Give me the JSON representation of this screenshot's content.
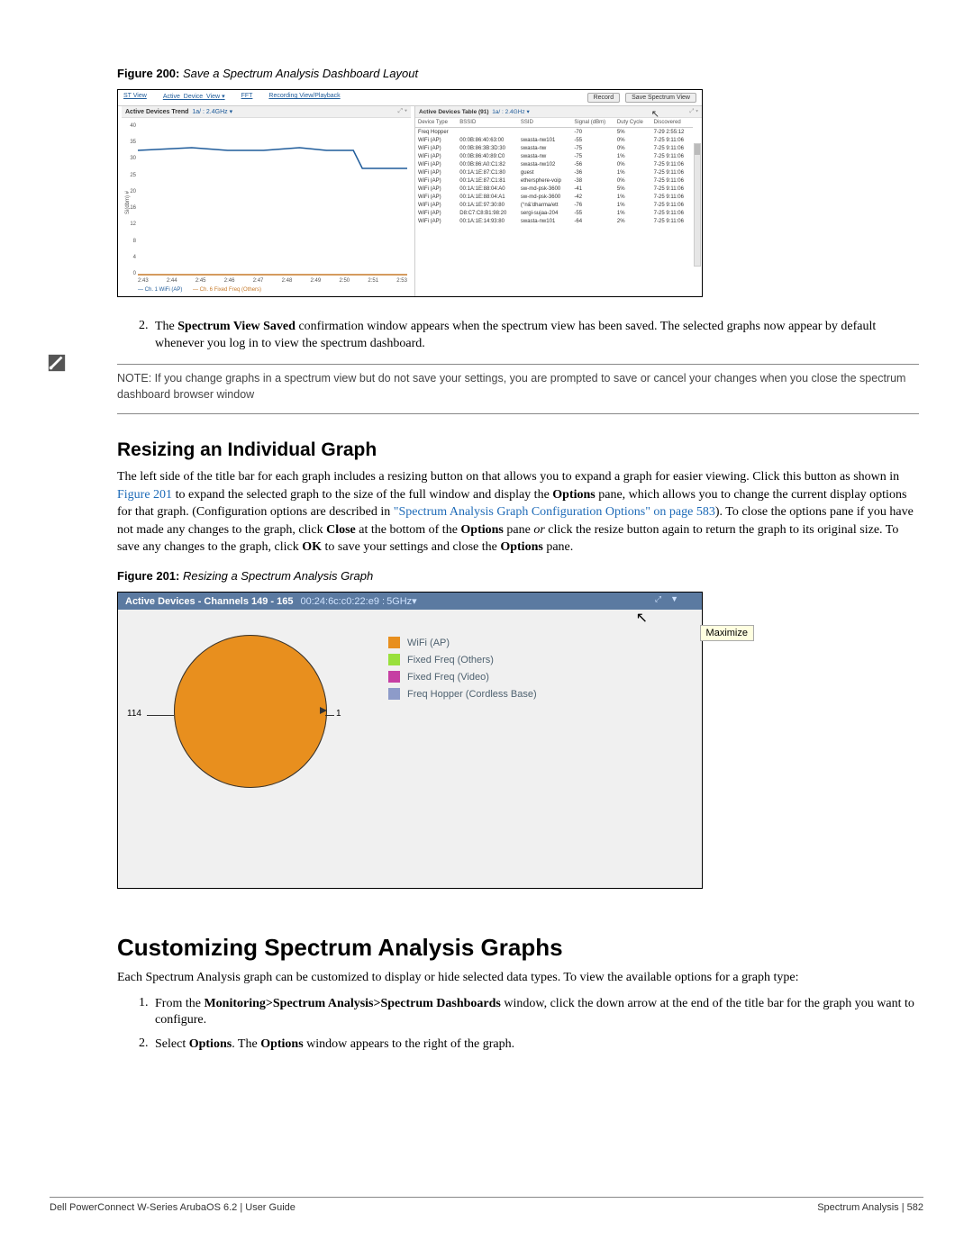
{
  "fig200": {
    "caption_label": "Figure 200:",
    "caption_title": "Save a Spectrum Analysis Dashboard Layout",
    "tabs": [
      "ST View",
      "Active_Device_View",
      "FFT",
      "Recording View/Playback"
    ],
    "buttons": {
      "record": "Record",
      "save": "Save Spectrum View"
    },
    "left_panel": {
      "title": "Active Devices Trend",
      "selector": "1a/ : 2.4GHz ▾",
      "y_label": "Si(dbm) #",
      "legend_a": "— Ch. 1 WiFi (AP)",
      "legend_b": "— Ch. 6 Fixed Freq (Others)"
    },
    "right_panel": {
      "title": "Active Devices Table (91)",
      "selector": "1a/ : 2.4GHz ▾",
      "columns": [
        "Device Type",
        "BSSID",
        "SSID",
        "Signal (dBm)",
        "Duty Cycle",
        "Discovered"
      ],
      "rows": [
        [
          "Freq Hopper",
          "",
          "",
          "-70",
          "5%",
          "7-29 2:55:12"
        ],
        [
          "WiFi (AP)",
          "00:0B:86:40:63:00",
          "swasta-nw101",
          "-55",
          "0%",
          "7-25 9:11:06"
        ],
        [
          "WiFi (AP)",
          "00:0B:86:3B:3D:30",
          "swasta-nw",
          "-75",
          "0%",
          "7-25 9:11:06"
        ],
        [
          "WiFi (AP)",
          "00:0B:86:40:89:C0",
          "swasta-nw",
          "-75",
          "1%",
          "7-25 9:11:06"
        ],
        [
          "WiFi (AP)",
          "00:0B:86:A0:C1:82",
          "swasta-nw102",
          "-56",
          "0%",
          "7-25 9:11:06"
        ],
        [
          "WiFi (AP)",
          "00:1A:1E:87:C1:80",
          "guest",
          "-36",
          "1%",
          "7-25 9:11:06"
        ],
        [
          "WiFi (AP)",
          "00:1A:1E:87:C1:81",
          "ethersphere-voip",
          "-38",
          "0%",
          "7-25 9:11:06"
        ],
        [
          "WiFi (AP)",
          "00:1A:1E:88:04:A0",
          "sw-md-psk-3600",
          "-41",
          "5%",
          "7-25 9:11:06"
        ],
        [
          "WiFi (AP)",
          "00:1A:1E:88:04:A1",
          "sw-md-psk-3600",
          "-42",
          "1%",
          "7-25 9:11:06"
        ],
        [
          "WiFi (AP)",
          "00:1A:1E:97:30:80",
          "(°n&'dharma/ett",
          "-76",
          "1%",
          "7-25 9:11:06"
        ],
        [
          "WiFi (AP)",
          "D8:C7:C8:B1:98:20",
          "sergi-sujaa-204",
          "-55",
          "1%",
          "7-25 9:11:06"
        ],
        [
          "WiFi (AP)",
          "00:1A:1E:14:93:80",
          "swasta-nw101",
          "-64",
          "2%",
          "7-25 9:11:06"
        ]
      ]
    }
  },
  "chart_data": [
    {
      "type": "line",
      "title": "Active Devices Trend",
      "xlabel": "",
      "ylabel": "Si(dbm) #",
      "ylim": [
        0,
        40
      ],
      "x": [
        "2:43",
        "2:44",
        "2:45",
        "2:46",
        "2:47",
        "2:48",
        "2:49",
        "2:50",
        "2:51",
        "2:53"
      ],
      "y_ticks": [
        0,
        4,
        8,
        12,
        16,
        20,
        25,
        30,
        35,
        40
      ],
      "series": [
        {
          "name": "Ch. 1 WiFi (AP)",
          "color": "#1e5b9a",
          "values": [
            33,
            34,
            33,
            33,
            34,
            33,
            33,
            33,
            28,
            28
          ]
        },
        {
          "name": "Ch. 6 Fixed Freq (Others)",
          "color": "#c77a2a",
          "values": [
            0,
            0,
            0,
            0,
            0,
            0,
            0,
            0,
            0,
            0
          ]
        }
      ]
    },
    {
      "type": "pie",
      "title": "Active Devices - Channels 149 - 165",
      "annotations": {
        "left_value": "114",
        "right_value": "1"
      },
      "series": [
        {
          "name": "WiFi (AP)",
          "color": "#e88f1e",
          "value": 114
        },
        {
          "name": "Fixed Freq (Others)",
          "color": "#99e03c",
          "value": 0
        },
        {
          "name": "Fixed Freq (Video)",
          "color": "#c63fa3",
          "value": 0
        },
        {
          "name": "Freq Hopper (Cordless Base)",
          "color": "#8d9bc9",
          "value": 1
        }
      ]
    }
  ],
  "step2": {
    "num": "2.",
    "text_a": "The ",
    "bold_a": "Spectrum View Saved",
    "text_b": " confirmation window appears when the spectrum view has been saved. The selected graphs now appear by default whenever you log in to view the spectrum dashboard."
  },
  "note": "NOTE: If you change graphs in a spectrum view but do not save your settings, you are prompted to save or cancel your changes when you close the spectrum dashboard browser window",
  "h3": "Resizing an Individual Graph",
  "para1": {
    "a": "The left side of the title bar for each graph includes a resizing button on that allows you to expand a graph for easier viewing. Click this button as shown in ",
    "link1": "Figure 201",
    "b": " to expand the selected graph to the size of the full window and display the ",
    "bold1": "Options",
    "c": " pane, which allows you to change the current display options for that graph. (Configuration options are described in ",
    "link2": "\"Spectrum Analysis Graph Configuration Options\" on page 583",
    "d": "). To close the options pane if you have not made any changes to the graph, click ",
    "bold2": "Close",
    "e": " at the bottom of the ",
    "bold3": "Options",
    "f": " pane ",
    "ital1": "or",
    "g": " click the resize button again to return the graph to its original size. To save any changes to the graph, click ",
    "bold4": "OK",
    "h": " to save your settings and close the ",
    "bold5": "Options",
    "i": " pane."
  },
  "fig201": {
    "caption_label": "Figure 201:",
    "caption_title": "Resizing a Spectrum Analysis Graph",
    "title": "Active Devices - Channels 149 - 165",
    "mac": "00:24:6c:c0:22:e9 :",
    "band": "5GHz▾",
    "tooltip": "Maximize",
    "legend": [
      {
        "color": "#e88f1e",
        "label": "WiFi (AP)"
      },
      {
        "color": "#99e03c",
        "label": "Fixed Freq (Others)"
      },
      {
        "color": "#c63fa3",
        "label": "Fixed Freq (Video)"
      },
      {
        "color": "#8d9bc9",
        "label": "Freq Hopper (Cordless Base)"
      }
    ],
    "val_left": "114",
    "val_right": "1"
  },
  "h2": "Customizing Spectrum Analysis Graphs",
  "para2": "Each Spectrum Analysis graph can be customized to display or hide selected data types. To view the available options for a graph type:",
  "cstep1": {
    "num": "1.",
    "a": "From the ",
    "bold": "Monitoring>Spectrum Analysis>Spectrum Dashboards",
    "b": " window, click the down arrow at the end of the title bar for the graph you want to configure."
  },
  "cstep2": {
    "num": "2.",
    "a": "Select ",
    "bold1": "Options",
    "b": ". The ",
    "bold2": "Options",
    "c": " window appears to the right of the graph."
  },
  "footer": {
    "left": "Dell PowerConnect W-Series ArubaOS 6.2  |  User Guide",
    "right": "Spectrum Analysis  |  582"
  }
}
